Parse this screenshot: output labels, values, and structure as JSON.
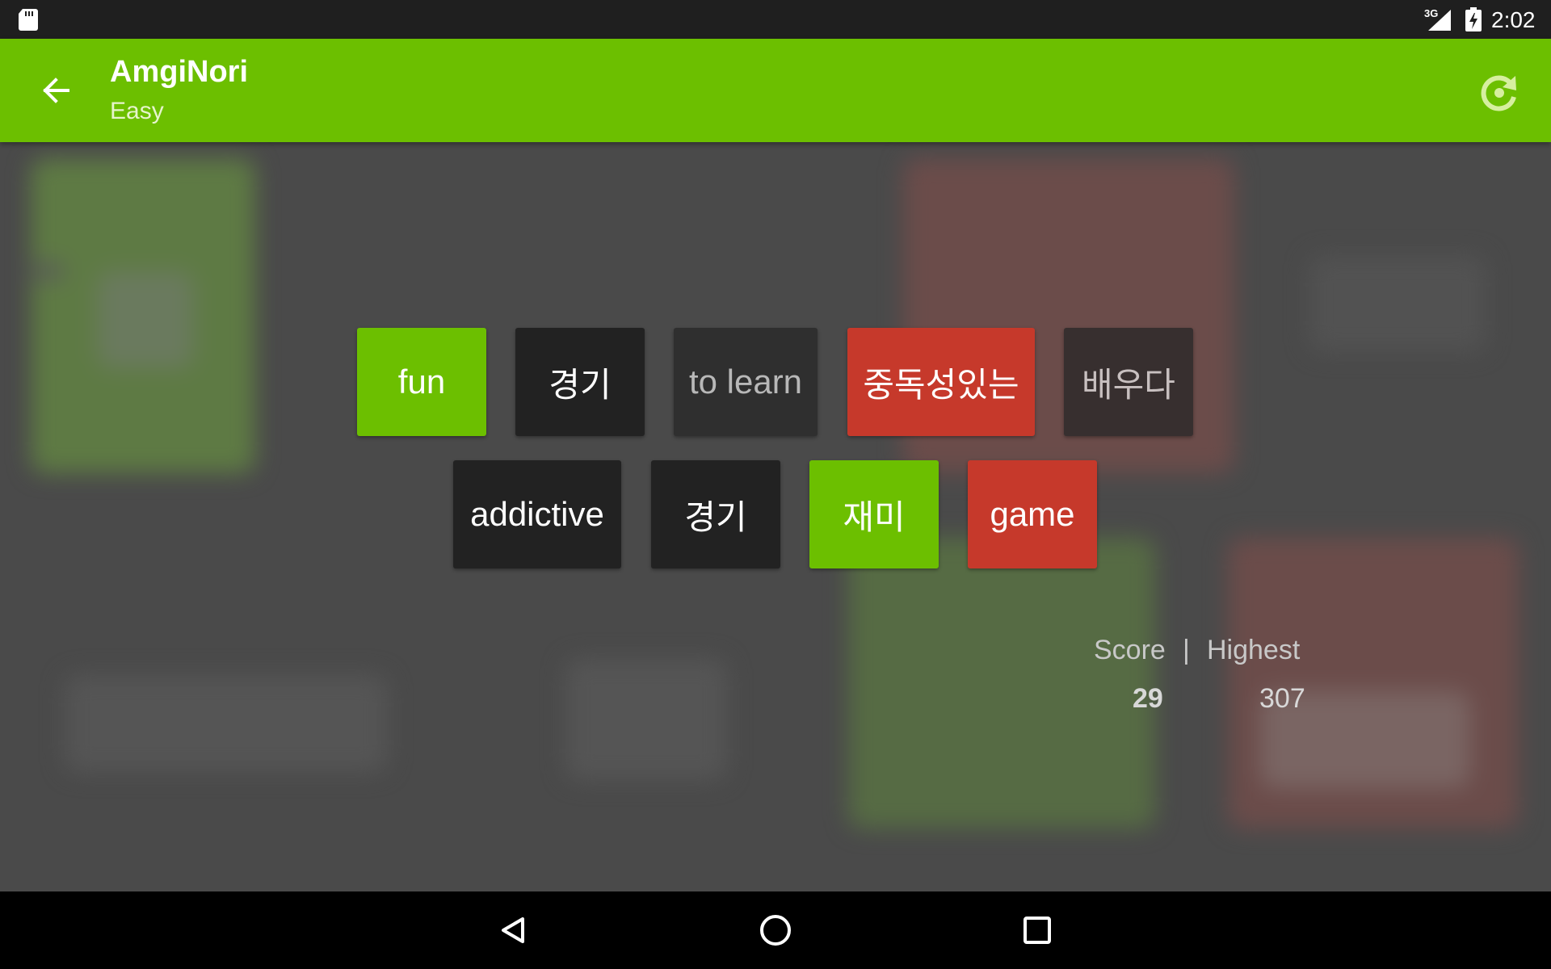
{
  "status_bar": {
    "network_type": "3G",
    "time": "2:02"
  },
  "app_bar": {
    "title": "AmgiNori",
    "subtitle": "Easy",
    "back_icon": "arrow-back-icon",
    "restart_icon": "restart-icon"
  },
  "board": {
    "row1": [
      {
        "label": "fun",
        "style": "green"
      },
      {
        "label": "경기",
        "style": "dark"
      },
      {
        "label": "to learn",
        "style": "dim"
      },
      {
        "label": "중독성있는",
        "style": "red"
      },
      {
        "label": "배우다",
        "style": "brown"
      }
    ],
    "row2": [
      {
        "label": "addictive",
        "style": "dark"
      },
      {
        "label": "경기",
        "style": "dark"
      },
      {
        "label": "재미",
        "style": "green"
      },
      {
        "label": "game",
        "style": "red"
      }
    ]
  },
  "score": {
    "score_label": "Score",
    "separator": "|",
    "highest_label": "Highest",
    "score_value": "29",
    "highest_value": "307"
  },
  "nav_bar": {
    "back_icon": "nav-back-icon",
    "home_icon": "nav-home-icon",
    "recents_icon": "nav-recents-icon"
  },
  "colors": {
    "accent_green": "#6cbf00",
    "tile_red": "#c6392b",
    "tile_dark": "#222222",
    "background": "#4a4a4a"
  }
}
